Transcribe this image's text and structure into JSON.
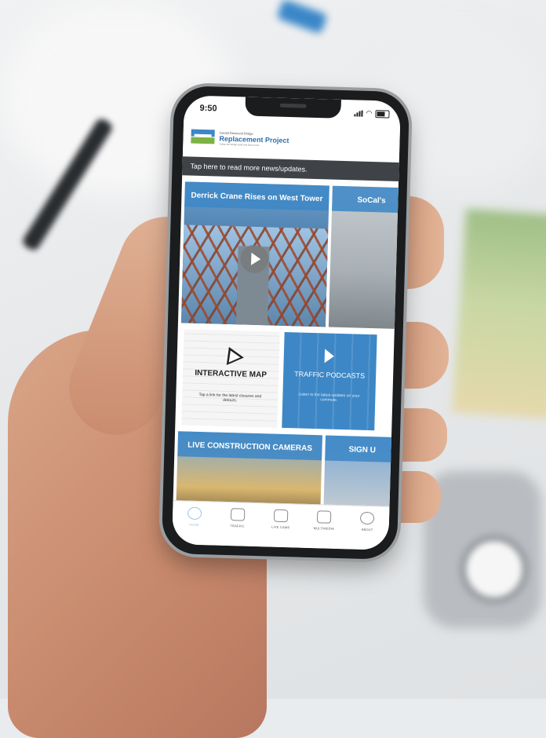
{
  "status_bar": {
    "time": "9:50"
  },
  "header": {
    "brand_small": "Gerald Desmond Bridge",
    "brand_name": "Replacement Project",
    "tagline": "Follow the bridge build and learn more."
  },
  "news_bar": {
    "label": "Tap here to read more news/updates."
  },
  "tiles": [
    {
      "title": "Derrick Crane Rises on West Tower",
      "has_video": true
    },
    {
      "title": "SoCal's"
    },
    {
      "title": "INTERACTIVE MAP",
      "subtitle": "Tap a link for the latest closures and detours.",
      "icon": "map-pointer-icon"
    },
    {
      "title": "TRAFFIC PODCASTS",
      "subtitle": "Listen to the latest updates on your commute.",
      "icon": "play-arrow-icon"
    },
    {
      "title": "LIVE CONSTRUCTION CAMERAS"
    },
    {
      "title": "SIGN U"
    }
  ],
  "tabbar": {
    "items": [
      {
        "label": "HOME",
        "icon": "home-icon",
        "active": true
      },
      {
        "label": "TRAFFIC",
        "icon": "car-icon",
        "active": false
      },
      {
        "label": "LIVE CAMS",
        "icon": "camera-icon",
        "active": false
      },
      {
        "label": "MULTIMEDIA",
        "icon": "video-icon",
        "active": false
      },
      {
        "label": "ABOUT",
        "icon": "info-icon",
        "active": false
      }
    ]
  },
  "colors": {
    "brand_blue": "#3d87c6",
    "brand_green": "#7cb342",
    "news_bar": "#3f4347",
    "tab_active": "#9ec3e4"
  }
}
